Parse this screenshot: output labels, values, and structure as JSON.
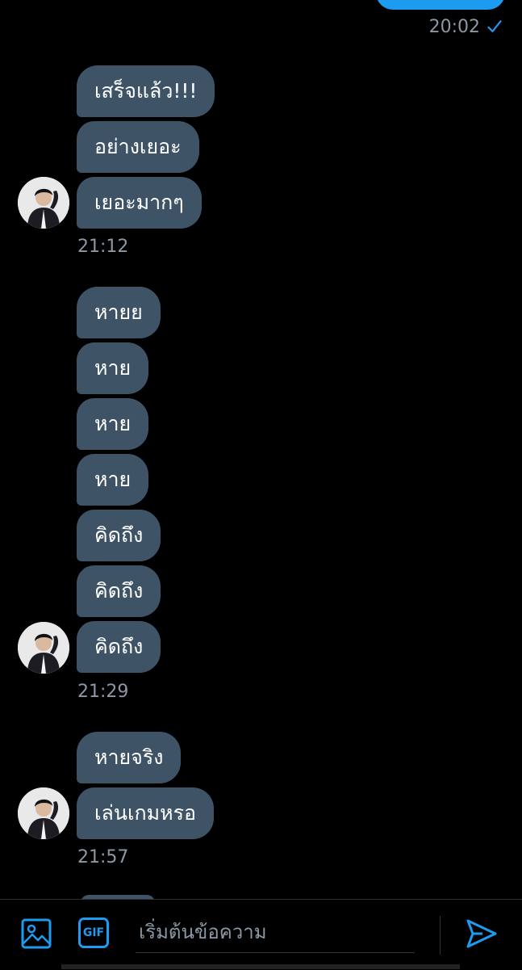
{
  "sent": {
    "time": "20:02"
  },
  "groups": [
    {
      "messages": [
        "เสร็จแล้ว!!!",
        "อย่างเยอะ",
        "เยอะมากๆ"
      ],
      "time": "21:12"
    },
    {
      "messages": [
        "หายย",
        "หาย",
        "หาย",
        "หาย",
        "คิดถึง",
        "คิดถึง",
        "คิดถึง"
      ],
      "time": "21:29"
    },
    {
      "messages": [
        "หายจริง",
        "เล่นเกมหรอ"
      ],
      "time": "21:57"
    }
  ],
  "composer": {
    "gif_label": "GIF",
    "placeholder": "เริ่มต้นข้อความ"
  },
  "colors": {
    "accent": "#1d9bf0",
    "received_bubble": "#3e5466",
    "timestamp": "#8b98a5",
    "background": "#000000"
  },
  "icons": {
    "read": "check-icon",
    "media": "image-icon",
    "gif": "gif-icon",
    "send": "send-icon"
  }
}
